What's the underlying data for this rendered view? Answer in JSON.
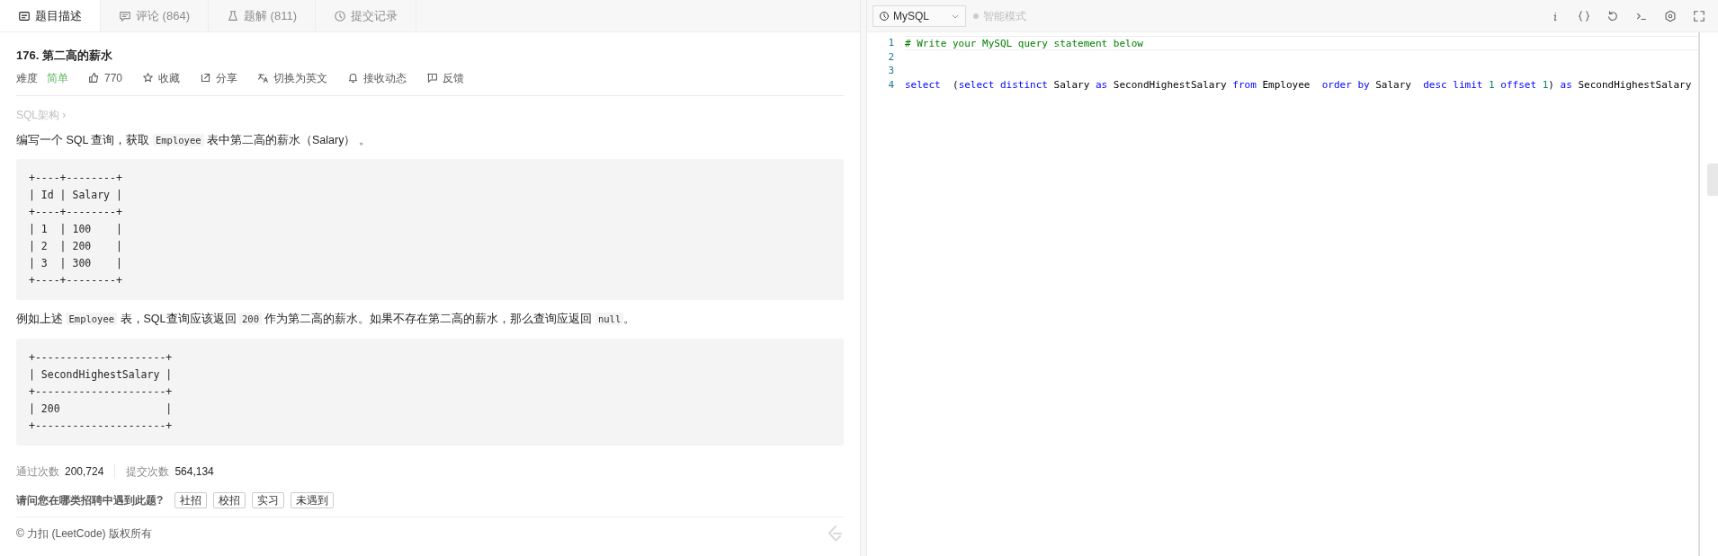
{
  "tabs": [
    {
      "label": "题目描述",
      "selected": true
    },
    {
      "label": "评论 (864)",
      "selected": false
    },
    {
      "label": "题解 (811)",
      "selected": false
    },
    {
      "label": "提交记录",
      "selected": false
    }
  ],
  "problem": {
    "title": "176. 第二高的薪水",
    "difficulty_label": "难度",
    "difficulty": "简单",
    "actions": [
      "770",
      "收藏",
      "分享",
      "切换为英文",
      "接收动态",
      "反馈"
    ],
    "breadcrumb": "SQL架构 ›",
    "content": [
      {
        "kind": "para",
        "parts": [
          {
            "t": "编写一个 SQL 查询，获取 "
          },
          {
            "code": "Employee"
          },
          {
            "t": " 表中第二高的薪水（Salary） 。"
          }
        ]
      },
      {
        "kind": "pre",
        "lines": [
          "+----+--------+",
          "| Id | Salary |",
          "+----+--------+",
          "| 1  | 100    |",
          "| 2  | 200    |",
          "| 3  | 300    |",
          "+----+--------+"
        ]
      },
      {
        "kind": "para",
        "parts": [
          {
            "t": "例如上述 "
          },
          {
            "code": "Employee"
          },
          {
            "t": " 表，SQL查询应该返回 "
          },
          {
            "code": "200"
          },
          {
            "t": " 作为第二高的薪水。如果不存在第二高的薪水，那么查询应返回 "
          },
          {
            "code": "null"
          },
          {
            "t": "。"
          }
        ]
      },
      {
        "kind": "pre",
        "lines": [
          "+---------------------+",
          "| SecondHighestSalary |",
          "+---------------------+",
          "| 200                 |",
          "+---------------------+"
        ]
      }
    ],
    "stats": [
      {
        "label": "通过次数",
        "value": "200,724"
      },
      {
        "label": "提交次数",
        "value": "564,134"
      }
    ],
    "question": "请问您在哪类招聘中遇到此题?",
    "answers": [
      "社招",
      "校招",
      "实习",
      "未遇到"
    ],
    "copyright": "© 力扣 (LeetCode) 版权所有"
  },
  "editor": {
    "language": "MySQL",
    "smart_mode": "智能模式",
    "lines": [
      {
        "number": "1",
        "tokens": [
          {
            "kind": "comment",
            "t": "# Write your MySQL query statement below"
          }
        ]
      },
      {
        "number": "2"
      },
      {
        "number": "3"
      },
      {
        "number": "4",
        "tokens": [
          {
            "kind": "keyword",
            "t": "select"
          },
          {
            "kind": "plain",
            "t": "  ("
          },
          {
            "kind": "keyword",
            "t": "select distinct"
          },
          {
            "kind": "plain",
            "t": " Salary "
          },
          {
            "kind": "keyword",
            "t": "as"
          },
          {
            "kind": "plain",
            "t": " SecondHighestSalary "
          },
          {
            "kind": "keyword",
            "t": "from"
          },
          {
            "kind": "plain",
            "t": " Employee  "
          },
          {
            "kind": "keyword",
            "t": "order by"
          },
          {
            "kind": "plain",
            "t": " Salary  "
          },
          {
            "kind": "keyword",
            "t": "desc limit "
          },
          {
            "kind": "number",
            "t": "1"
          },
          {
            "kind": "keyword",
            "t": " offset "
          },
          {
            "kind": "number",
            "t": "1"
          },
          {
            "kind": "plain",
            "t": ") "
          },
          {
            "kind": "keyword",
            "t": "as"
          },
          {
            "kind": "plain",
            "t": " SecondHighestSalary"
          }
        ]
      }
    ]
  }
}
